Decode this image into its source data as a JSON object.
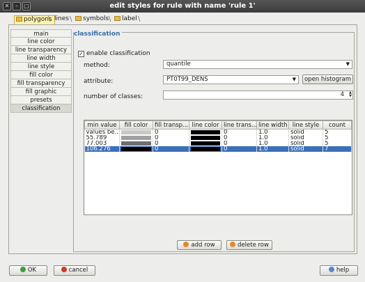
{
  "window": {
    "title": "edit styles for rule with name 'rule 1'"
  },
  "tabs": [
    {
      "label": "polygons",
      "active": true
    },
    {
      "label": "lines",
      "active": false
    },
    {
      "label": "symbols",
      "active": false
    },
    {
      "label": "label",
      "active": false
    }
  ],
  "sidebar": {
    "items": [
      {
        "label": "main"
      },
      {
        "label": "line color"
      },
      {
        "label": "line transparency"
      },
      {
        "label": "line width"
      },
      {
        "label": "line style"
      },
      {
        "label": "fill color"
      },
      {
        "label": "fill transparency"
      },
      {
        "label": "fill graphic"
      },
      {
        "label": "presets"
      },
      {
        "label": "classification",
        "selected": true
      }
    ]
  },
  "classification": {
    "section_title": "classification",
    "enable_label": "enable classification",
    "enabled": true,
    "method_label": "method:",
    "method_value": "quantile",
    "attribute_label": "attribute:",
    "attribute_value": "PT0T99_DENS",
    "open_histogram_label": "open histogram",
    "classes_label": "number of classes:",
    "classes_value": "4"
  },
  "table": {
    "columns": [
      "min value",
      "fill color",
      "fill transp...",
      "line color",
      "line trans...",
      "line width",
      "line style",
      "count"
    ],
    "rows": [
      {
        "min": "values be...",
        "fill": "#c8c8c8",
        "fill_transp": "0",
        "line": "#000000",
        "line_transp": "0",
        "width": "1.0",
        "style": "solid",
        "count": "5",
        "selected": false
      },
      {
        "min": "55.789",
        "fill": "#a0a0a0",
        "fill_transp": "0",
        "line": "#000000",
        "line_transp": "0",
        "width": "1.0",
        "style": "solid",
        "count": "5",
        "selected": false
      },
      {
        "min": "77.003",
        "fill": "#6e6e6e",
        "fill_transp": "0",
        "line": "#000000",
        "line_transp": "0",
        "width": "1.0",
        "style": "solid",
        "count": "5",
        "selected": false
      },
      {
        "min": "106.276",
        "fill": "#000000",
        "fill_transp": "0",
        "line": "#000000",
        "line_transp": "0",
        "width": "1.0",
        "style": "solid",
        "count": "7",
        "selected": true
      }
    ]
  },
  "actions": {
    "add_row": "add row",
    "delete_row": "delete row"
  },
  "footer": {
    "ok": "OK",
    "cancel": "cancel",
    "help": "help"
  },
  "colors": {
    "accent": "#3b6fb8",
    "ok_icon": "#3aa03a",
    "cancel_icon": "#d03a2a",
    "help_icon": "#5a86c8"
  }
}
